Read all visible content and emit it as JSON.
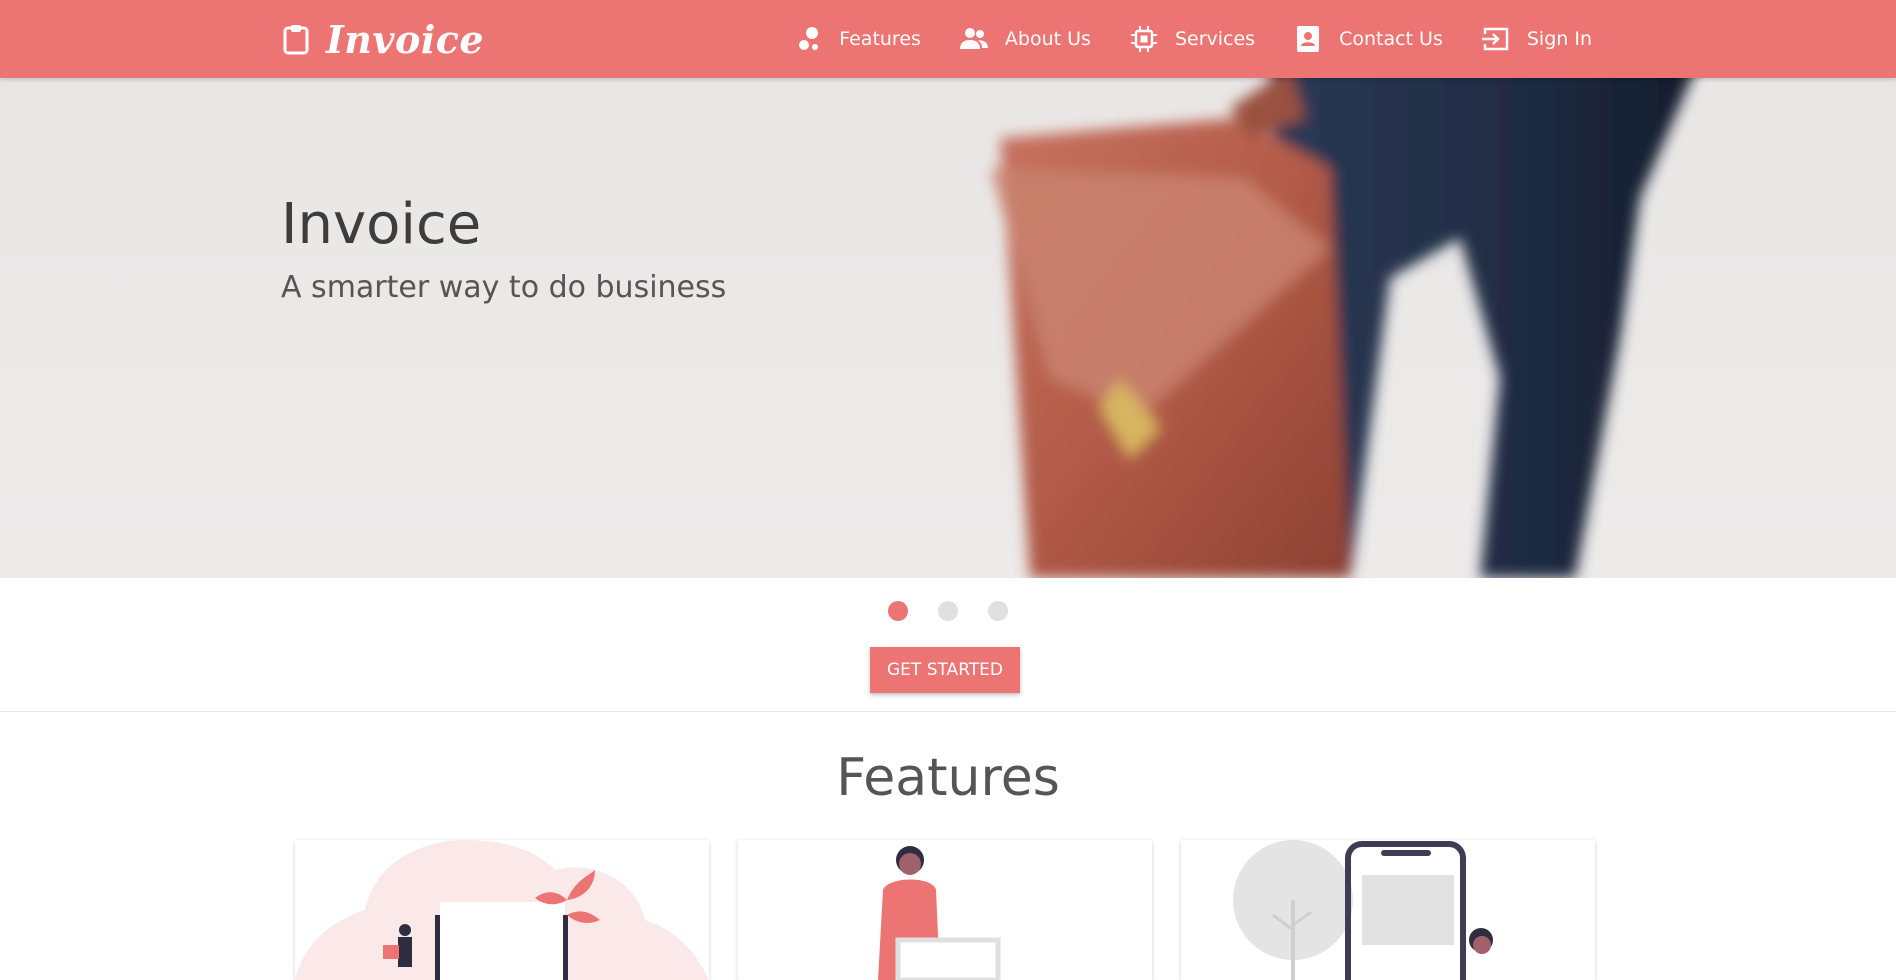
{
  "brand": {
    "name": "Invoice",
    "icon": "clipboard-icon"
  },
  "nav": [
    {
      "label": "Features",
      "icon": "bubbles-icon"
    },
    {
      "label": "About Us",
      "icon": "people-icon"
    },
    {
      "label": "Services",
      "icon": "chip-icon"
    },
    {
      "label": "Contact Us",
      "icon": "contact-card-icon"
    },
    {
      "label": "Sign In",
      "icon": "sign-in-icon"
    }
  ],
  "hero": {
    "title": "Invoice",
    "subtitle": "A smarter way to do business",
    "slides": 3,
    "active_slide": 1
  },
  "cta": {
    "label": "GET STARTED"
  },
  "features": {
    "title": "Features"
  },
  "colors": {
    "accent": "#ec7472",
    "dot_inactive": "#e0e0e0"
  }
}
